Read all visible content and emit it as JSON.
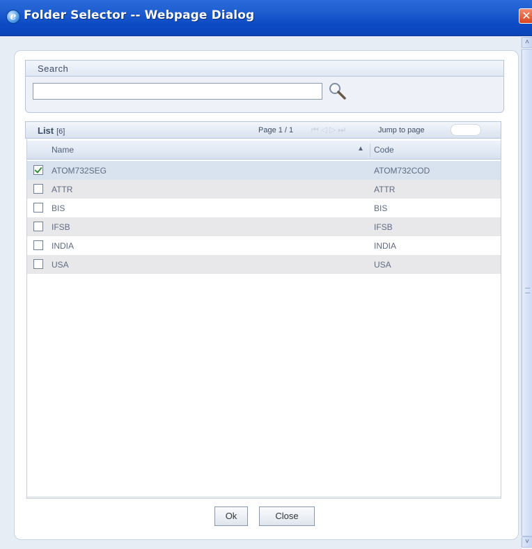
{
  "window": {
    "title": "Folder Selector -- Webpage Dialog",
    "close_glyph": "✕"
  },
  "search": {
    "label": "Search",
    "value": "",
    "placeholder": ""
  },
  "list": {
    "title": "List",
    "count": "[6]",
    "page_info": "Page 1 / 1",
    "pager_glyphs": "⏮◁▷⏭",
    "jump_label": "Jump to page",
    "columns": {
      "name": "Name",
      "code": "Code",
      "sort_indicator": "▲"
    },
    "rows": [
      {
        "name": "ATOM732SEG",
        "code": "ATOM732COD",
        "checked": true
      },
      {
        "name": "ATTR",
        "code": "ATTR",
        "checked": false
      },
      {
        "name": "BIS",
        "code": "BIS",
        "checked": false
      },
      {
        "name": "IFSB",
        "code": "IFSB",
        "checked": false
      },
      {
        "name": "INDIA",
        "code": "INDIA",
        "checked": false
      },
      {
        "name": "USA",
        "code": "USA",
        "checked": false
      }
    ]
  },
  "footer": {
    "ok_label": "Ok",
    "close_label": "Close"
  },
  "scroll": {
    "up": "˄",
    "down": "˅"
  },
  "colors": {
    "titlebar": "#0c4ac4",
    "panel_header": "#dfe7f3",
    "row_alt": "#e8e8ea",
    "row_selected": "#d8e3ef",
    "check": "#2f8d2f"
  },
  "icons": {
    "app": "ie-icon",
    "search": "magnifier-icon"
  }
}
